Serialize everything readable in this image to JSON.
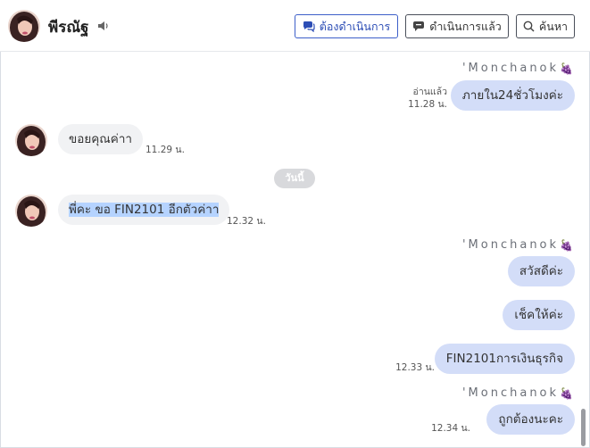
{
  "header": {
    "contact_name": "พีรณัฐ",
    "buttons": {
      "pending": "ต้องดำเนินการ",
      "done": "ดำเนินการแล้ว",
      "search": "ค้นหา"
    },
    "accent_color": "#3d5fc9"
  },
  "chat": {
    "date_divider": "วันนี้",
    "messages": [
      {
        "direction": "out",
        "sender": "'Monchanok",
        "sender_emoji": "grape",
        "text": "ภายใน24ชั่วโมงค่ะ",
        "read": "อ่านแล้ว",
        "time": "11.28 น."
      },
      {
        "direction": "in",
        "text": "ขอยคุณค่าา",
        "time": "11.29 น."
      },
      {
        "direction": "in",
        "text": "พี่คะ ขอ FIN2101 อีกตัวค่าา",
        "time": "12.32 น.",
        "selected": true
      },
      {
        "direction": "out",
        "sender": "'Monchanok",
        "sender_emoji": "grape",
        "text": "สวัสดีค่ะ"
      },
      {
        "direction": "out",
        "text": "เช็คให้ค่ะ"
      },
      {
        "direction": "out",
        "text": "FIN2101การเงินธุรกิจ",
        "time": "12.33 น."
      },
      {
        "direction": "out",
        "sender": "'Monchanok",
        "sender_emoji": "grape",
        "text": "ถูกต้องนะคะ",
        "time": "12.34 น."
      }
    ],
    "outgoing_bubble_color": "#d3ddf8",
    "incoming_bubble_color": "#f1f2f4"
  }
}
